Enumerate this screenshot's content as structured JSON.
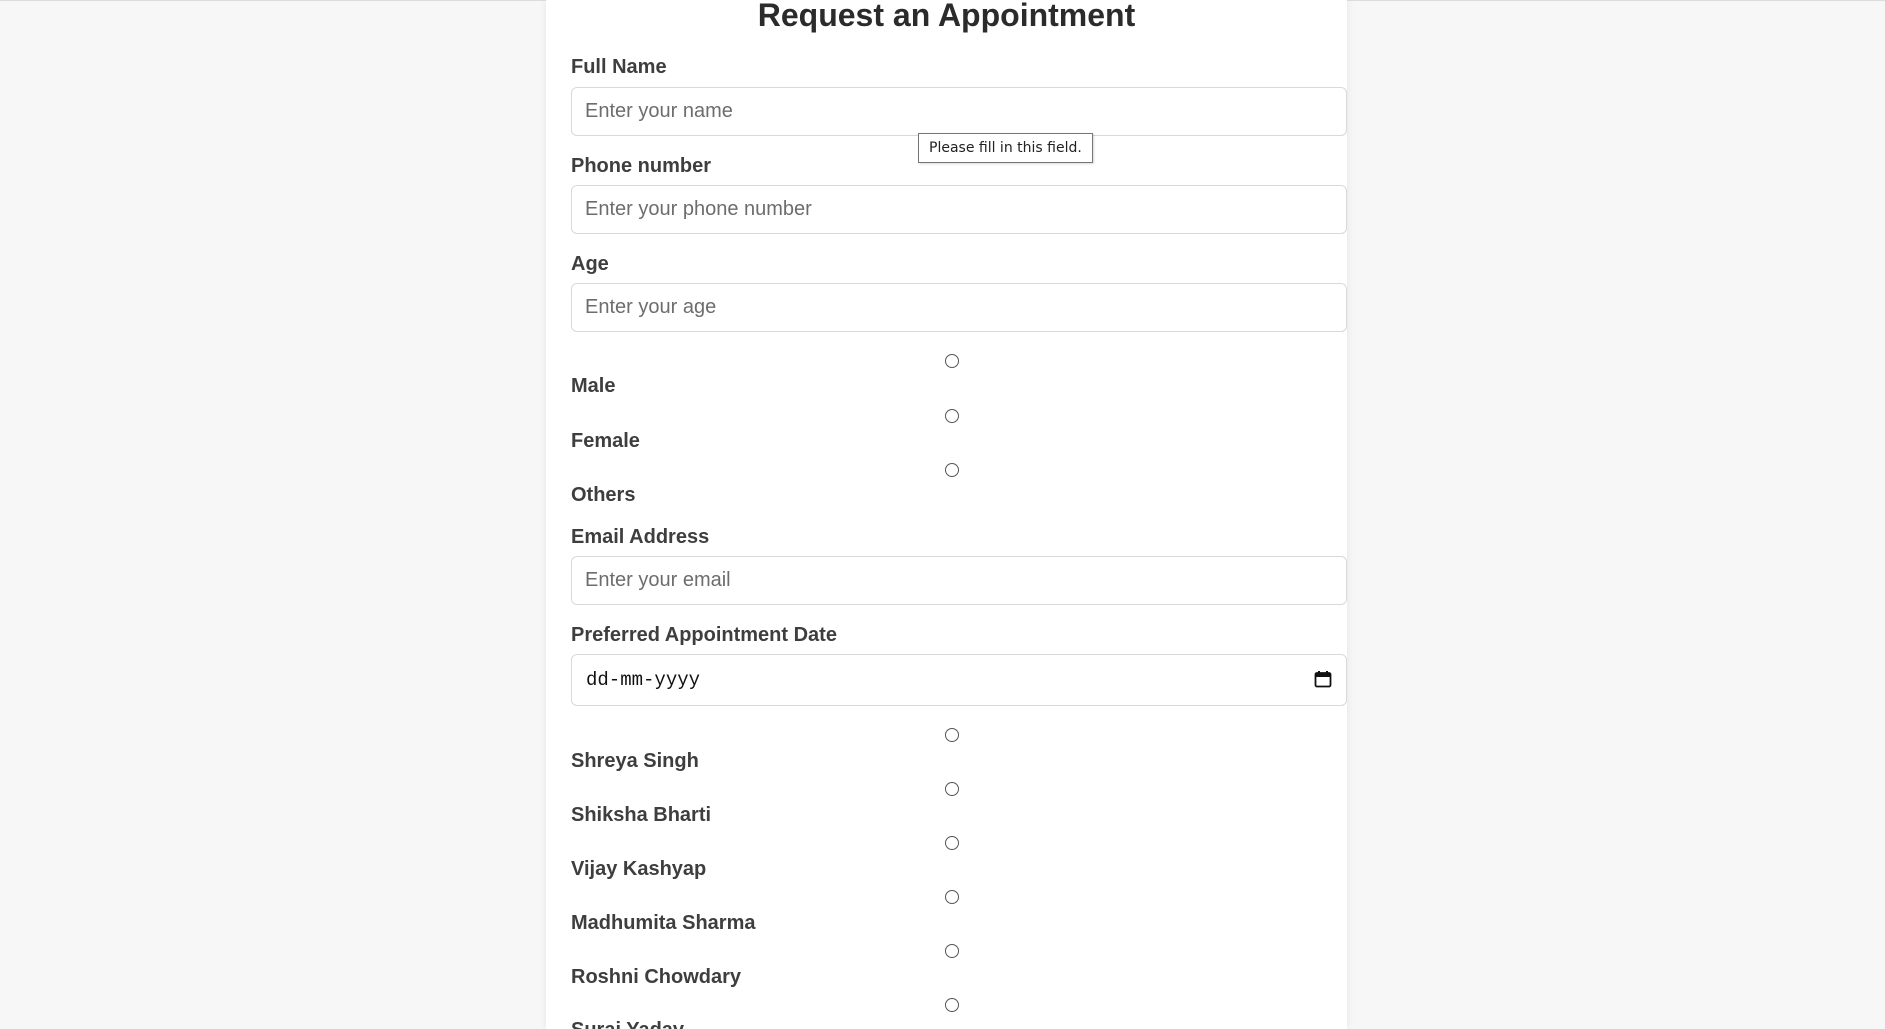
{
  "form": {
    "title": "Request an Appointment",
    "full_name": {
      "label": "Full Name",
      "placeholder": "Enter your name"
    },
    "phone": {
      "label": "Phone number",
      "placeholder": "Enter your phone number"
    },
    "age": {
      "label": "Age",
      "placeholder": "Enter your age"
    },
    "gender_options": [
      "Male",
      "Female",
      "Others"
    ],
    "email": {
      "label": "Email Address",
      "placeholder": "Enter your email"
    },
    "date": {
      "label": "Preferred Appointment Date",
      "placeholder": "dd-mm-yyyy"
    },
    "doctor_options": [
      "Shreya Singh",
      "Shiksha Bharti",
      "Vijay Kashyap",
      "Madhumita Sharma",
      "Roshni Chowdary",
      "Suraj Yadav"
    ]
  },
  "tooltip": {
    "text": "Please fill in this field."
  },
  "icons": {
    "calendar": "calendar-icon"
  }
}
